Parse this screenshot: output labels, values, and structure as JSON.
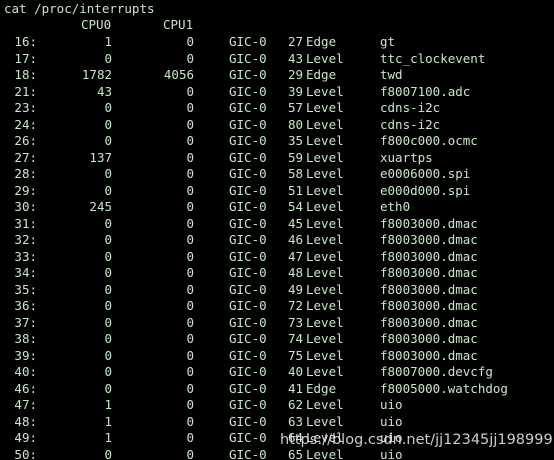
{
  "command": "cat /proc/interrupts",
  "headers": {
    "cpu0": "CPU0",
    "cpu1": "CPU1"
  },
  "rows": [
    {
      "irq": "16:",
      "cpu0": "1",
      "cpu1": "0",
      "chip": "GIC-0",
      "hwirq": "27",
      "type": "Edge",
      "name": "gt"
    },
    {
      "irq": "17:",
      "cpu0": "0",
      "cpu1": "0",
      "chip": "GIC-0",
      "hwirq": "43",
      "type": "Level",
      "name": "ttc_clockevent"
    },
    {
      "irq": "18:",
      "cpu0": "1782",
      "cpu1": "4056",
      "chip": "GIC-0",
      "hwirq": "29",
      "type": "Edge",
      "name": "twd"
    },
    {
      "irq": "21:",
      "cpu0": "43",
      "cpu1": "0",
      "chip": "GIC-0",
      "hwirq": "39",
      "type": "Level",
      "name": "f8007100.adc"
    },
    {
      "irq": "23:",
      "cpu0": "0",
      "cpu1": "0",
      "chip": "GIC-0",
      "hwirq": "57",
      "type": "Level",
      "name": "cdns-i2c"
    },
    {
      "irq": "24:",
      "cpu0": "0",
      "cpu1": "0",
      "chip": "GIC-0",
      "hwirq": "80",
      "type": "Level",
      "name": "cdns-i2c"
    },
    {
      "irq": "26:",
      "cpu0": "0",
      "cpu1": "0",
      "chip": "GIC-0",
      "hwirq": "35",
      "type": "Level",
      "name": "f800c000.ocmc"
    },
    {
      "irq": "27:",
      "cpu0": "137",
      "cpu1": "0",
      "chip": "GIC-0",
      "hwirq": "59",
      "type": "Level",
      "name": "xuartps"
    },
    {
      "irq": "28:",
      "cpu0": "0",
      "cpu1": "0",
      "chip": "GIC-0",
      "hwirq": "58",
      "type": "Level",
      "name": "e0006000.spi"
    },
    {
      "irq": "29:",
      "cpu0": "0",
      "cpu1": "0",
      "chip": "GIC-0",
      "hwirq": "51",
      "type": "Level",
      "name": "e000d000.spi"
    },
    {
      "irq": "30:",
      "cpu0": "245",
      "cpu1": "0",
      "chip": "GIC-0",
      "hwirq": "54",
      "type": "Level",
      "name": "eth0"
    },
    {
      "irq": "31:",
      "cpu0": "0",
      "cpu1": "0",
      "chip": "GIC-0",
      "hwirq": "45",
      "type": "Level",
      "name": "f8003000.dmac"
    },
    {
      "irq": "32:",
      "cpu0": "0",
      "cpu1": "0",
      "chip": "GIC-0",
      "hwirq": "46",
      "type": "Level",
      "name": "f8003000.dmac"
    },
    {
      "irq": "33:",
      "cpu0": "0",
      "cpu1": "0",
      "chip": "GIC-0",
      "hwirq": "47",
      "type": "Level",
      "name": "f8003000.dmac"
    },
    {
      "irq": "34:",
      "cpu0": "0",
      "cpu1": "0",
      "chip": "GIC-0",
      "hwirq": "48",
      "type": "Level",
      "name": "f8003000.dmac"
    },
    {
      "irq": "35:",
      "cpu0": "0",
      "cpu1": "0",
      "chip": "GIC-0",
      "hwirq": "49",
      "type": "Level",
      "name": "f8003000.dmac"
    },
    {
      "irq": "36:",
      "cpu0": "0",
      "cpu1": "0",
      "chip": "GIC-0",
      "hwirq": "72",
      "type": "Level",
      "name": "f8003000.dmac"
    },
    {
      "irq": "37:",
      "cpu0": "0",
      "cpu1": "0",
      "chip": "GIC-0",
      "hwirq": "73",
      "type": "Level",
      "name": "f8003000.dmac"
    },
    {
      "irq": "38:",
      "cpu0": "0",
      "cpu1": "0",
      "chip": "GIC-0",
      "hwirq": "74",
      "type": "Level",
      "name": "f8003000.dmac"
    },
    {
      "irq": "39:",
      "cpu0": "0",
      "cpu1": "0",
      "chip": "GIC-0",
      "hwirq": "75",
      "type": "Level",
      "name": "f8003000.dmac"
    },
    {
      "irq": "40:",
      "cpu0": "0",
      "cpu1": "0",
      "chip": "GIC-0",
      "hwirq": "40",
      "type": "Level",
      "name": "f8007000.devcfg"
    },
    {
      "irq": "46:",
      "cpu0": "0",
      "cpu1": "0",
      "chip": "GIC-0",
      "hwirq": "41",
      "type": "Edge",
      "name": "f8005000.watchdog"
    },
    {
      "irq": "47:",
      "cpu0": "1",
      "cpu1": "0",
      "chip": "GIC-0",
      "hwirq": "62",
      "type": "Level",
      "name": "uio"
    },
    {
      "irq": "48:",
      "cpu0": "1",
      "cpu1": "0",
      "chip": "GIC-0",
      "hwirq": "63",
      "type": "Level",
      "name": "uio"
    },
    {
      "irq": "49:",
      "cpu0": "1",
      "cpu1": "0",
      "chip": "GIC-0",
      "hwirq": "64",
      "type": "Level",
      "name": "uio"
    },
    {
      "irq": "50:",
      "cpu0": "0",
      "cpu1": "0",
      "chip": "GIC-0",
      "hwirq": "65",
      "type": "Level",
      "name": "uio"
    }
  ],
  "watermark": "https://blog.csdn.net/jj12345jj198999",
  "colors": {
    "background": "#000000",
    "text": "#c8e6c8",
    "watermark": "#e8e8e8"
  }
}
